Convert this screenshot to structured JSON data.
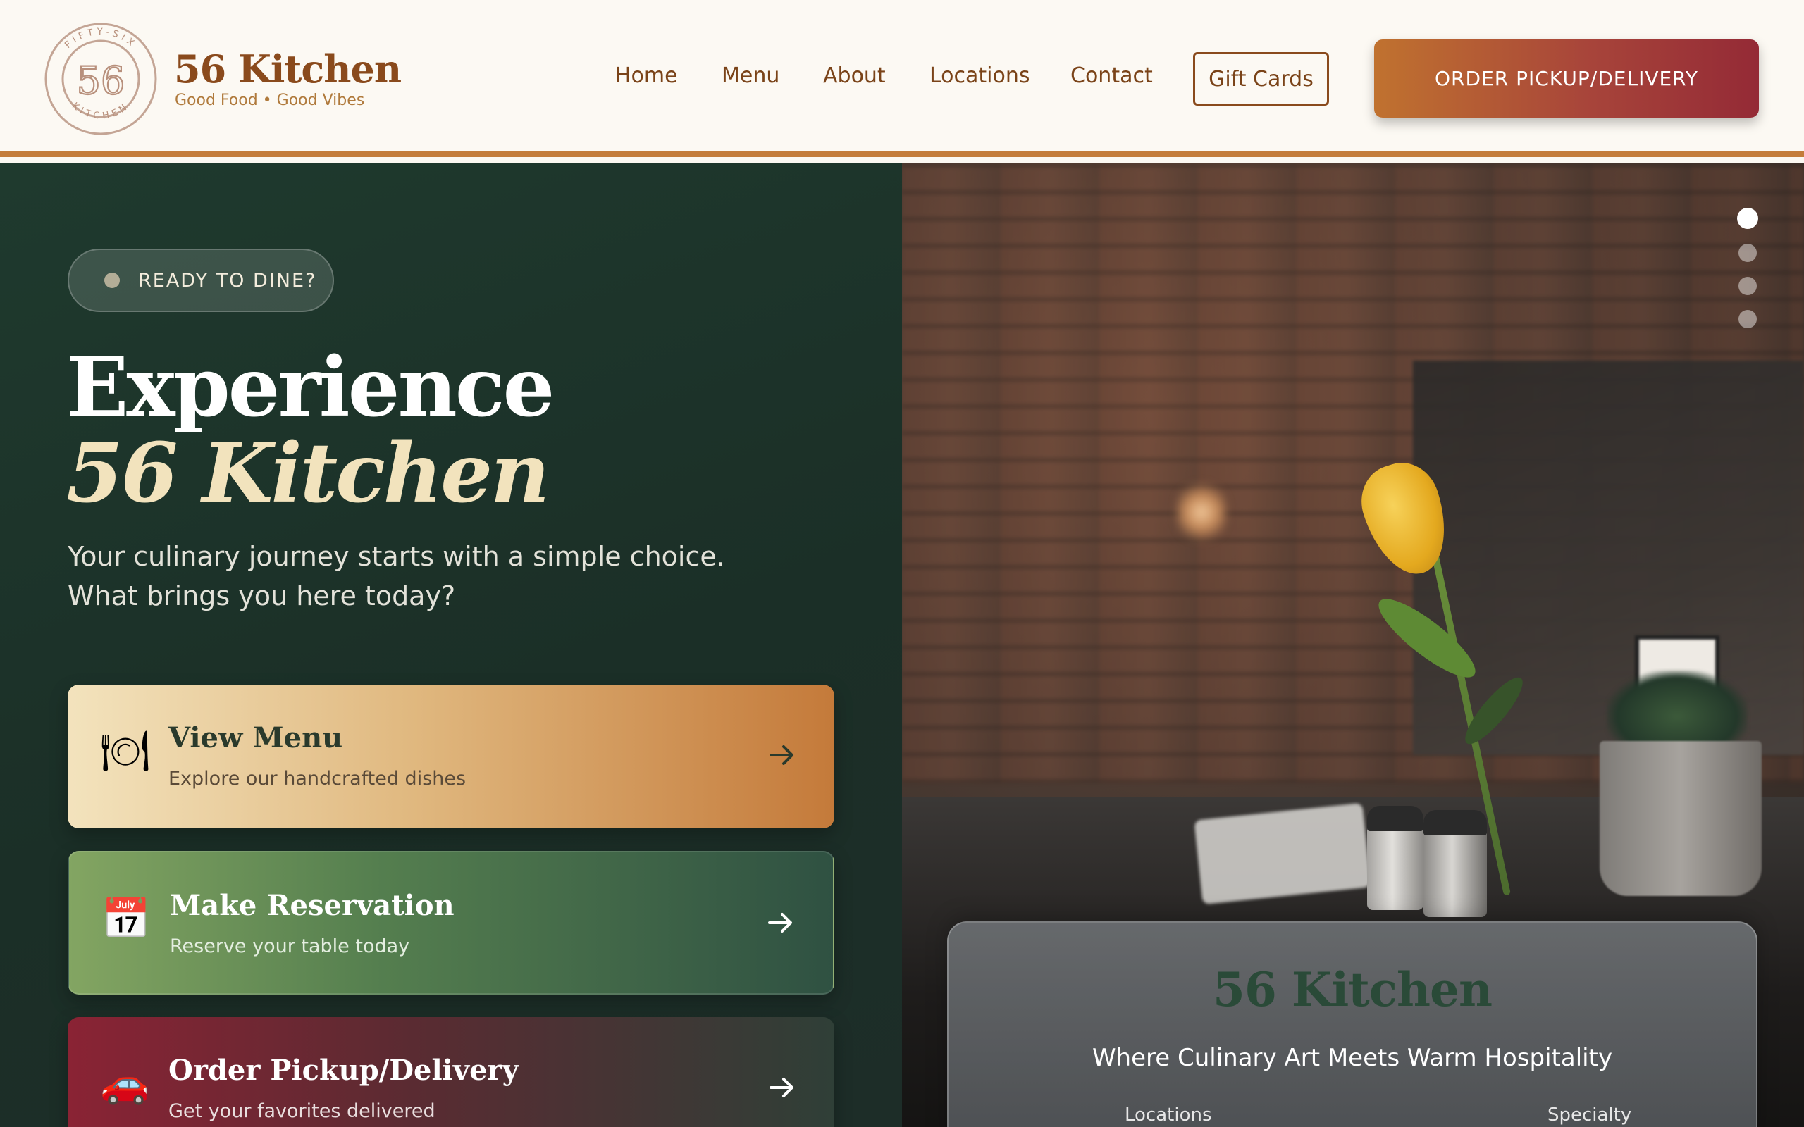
{
  "header": {
    "logo": {
      "ring_text_top": "FIFTY-SIX",
      "ring_text_bottom": "KITCHEN",
      "monogram": "56"
    },
    "brand_name": "56 Kitchen",
    "brand_tagline": "Good Food • Good Vibes",
    "nav": [
      "Home",
      "Menu",
      "About",
      "Locations",
      "Contact"
    ],
    "gift_cards": "Gift Cards",
    "order_button": "ORDER PICKUP/DELIVERY"
  },
  "hero": {
    "badge": "READY TO DINE?",
    "title_line1": "Experience",
    "title_line2": "56 Kitchen",
    "subtitle_line1": "Your culinary journey starts with a simple choice.",
    "subtitle_line2": "What brings you here today?"
  },
  "cards": [
    {
      "icon": "plate-icon",
      "glyph": "🍽",
      "title": "View Menu",
      "subtitle": "Explore our handcrafted dishes"
    },
    {
      "icon": "calendar-icon",
      "glyph": "📅",
      "title": "Make Reservation",
      "subtitle": "Reserve your table today"
    },
    {
      "icon": "car-icon",
      "glyph": "🚗",
      "title": "Order Pickup/Delivery",
      "subtitle": "Get your favorites delivered"
    }
  ],
  "carousel": {
    "slide_count": 4,
    "active_index": 0
  },
  "info_card": {
    "title": "56 Kitchen",
    "subtitle": "Where Culinary Art Meets Warm Hospitality",
    "col_left": "Locations",
    "col_right": "Specialty"
  },
  "colors": {
    "brand_brown": "#8a4a1c",
    "accent_orange": "#c47c3a",
    "hero_green": "#1f3a2e",
    "hero_cream": "#f2e3bd",
    "wine_red": "#942a36"
  }
}
